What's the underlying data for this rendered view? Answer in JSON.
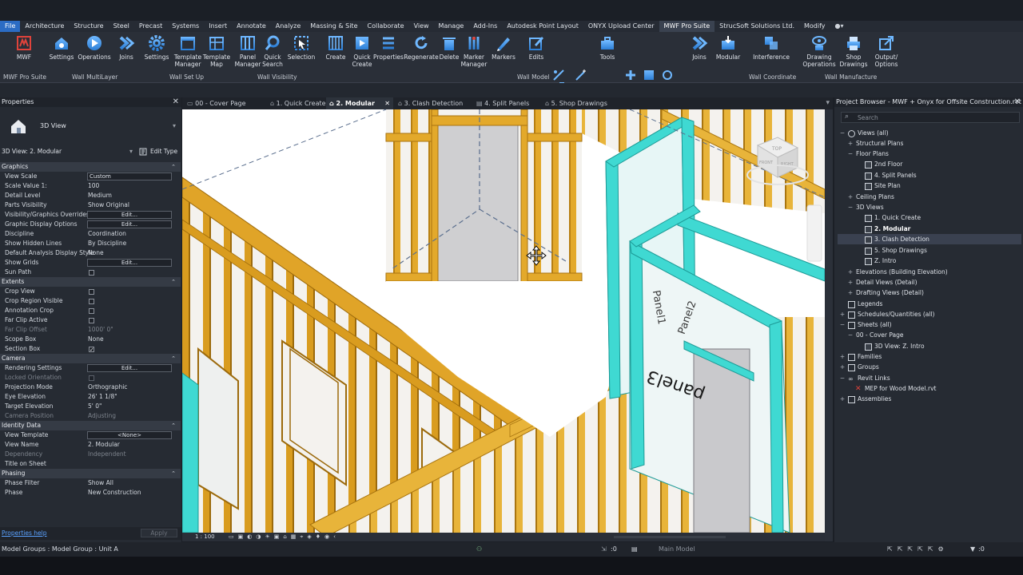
{
  "menus": [
    "File",
    "Architecture",
    "Structure",
    "Steel",
    "Precast",
    "Systems",
    "Insert",
    "Annotate",
    "Analyze",
    "Massing & Site",
    "Collaborate",
    "View",
    "Manage",
    "Add-Ins",
    "Autodesk Point Layout",
    "ONYX Upload Center",
    "MWF Pro Suite",
    "StrucSoft Solutions Ltd.",
    "Modify"
  ],
  "ribbon": {
    "buttons": {
      "mwf": "MWF",
      "settings1": "Settings",
      "operations": "Operations",
      "joins1": "Joins",
      "settings2": "Settings",
      "template_manager": "Template\nManager",
      "template_map": "Template\nMap",
      "panel_manager": "Panel\nManager",
      "quick_search": "Quick\nSearch",
      "selection": "Selection",
      "create": "Create",
      "quick_create": "Quick\nCreate",
      "properties": "Properties",
      "regenerate": "Regenerate",
      "delete": "Delete",
      "marker_manager": "Marker\nManager",
      "markers": "Markers",
      "edits": "Edits",
      "tools": "Tools",
      "joins2": "Joins",
      "modular": "Modular",
      "interference": "Interference",
      "drawing_operations": "Drawing\nOperations",
      "shop_drawings": "Shop\nDrawings",
      "output_options": "Output/\nOptions"
    },
    "groups": {
      "mwf_pro_suite": "MWF Pro Suite",
      "wall_multilayer": "Wall MultiLayer",
      "wall_set_up": "Wall Set Up",
      "wall_visibility": "Wall Visibility",
      "wall_model": "Wall Model",
      "wall_coordinate": "Wall Coordinate",
      "wall_manufacture": "Wall Manufacture"
    }
  },
  "properties": {
    "title": "Properties",
    "type_name": "3D View",
    "selector": "3D View: 2. Modular",
    "edit_type": "Edit Type",
    "sections": {
      "graphics": "Graphics",
      "extents": "Extents",
      "camera": "Camera",
      "identity": "Identity Data",
      "phasing": "Phasing"
    },
    "rows": {
      "view_scale": {
        "k": "View Scale",
        "v": "Custom"
      },
      "scale_value": {
        "k": "Scale Value    1:",
        "v": "100"
      },
      "detail_level": {
        "k": "Detail Level",
        "v": "Medium"
      },
      "parts_visibility": {
        "k": "Parts Visibility",
        "v": "Show Original"
      },
      "vg_overrides": {
        "k": "Visibility/Graphics Overrides",
        "v": "Edit..."
      },
      "graphic_display": {
        "k": "Graphic Display Options",
        "v": "Edit..."
      },
      "discipline": {
        "k": "Discipline",
        "v": "Coordination"
      },
      "hidden_lines": {
        "k": "Show Hidden Lines",
        "v": "By Discipline"
      },
      "analysis_style": {
        "k": "Default Analysis Display Style",
        "v": "None"
      },
      "show_grids": {
        "k": "Show Grids",
        "v": "Edit..."
      },
      "sun_path": {
        "k": "Sun Path"
      },
      "crop_view": {
        "k": "Crop View"
      },
      "crop_region": {
        "k": "Crop Region Visible"
      },
      "annotation_crop": {
        "k": "Annotation Crop"
      },
      "far_clip_active": {
        "k": "Far Clip Active"
      },
      "far_clip_offset": {
        "k": "Far Clip Offset",
        "v": "1000'  0\""
      },
      "scope_box": {
        "k": "Scope Box",
        "v": "None"
      },
      "section_box": {
        "k": "Section Box"
      },
      "rendering": {
        "k": "Rendering Settings",
        "v": "Edit..."
      },
      "locked_orientation": {
        "k": "Locked Orientation"
      },
      "projection": {
        "k": "Projection Mode",
        "v": "Orthographic"
      },
      "eye_elevation": {
        "k": "Eye Elevation",
        "v": "26'  1 1/8\""
      },
      "target_elevation": {
        "k": "Target Elevation",
        "v": "5'  0\""
      },
      "camera_position": {
        "k": "Camera Position",
        "v": "Adjusting"
      },
      "view_template": {
        "k": "View Template",
        "v": "<None>"
      },
      "view_name": {
        "k": "View Name",
        "v": "2. Modular"
      },
      "dependency": {
        "k": "Dependency",
        "v": "Independent"
      },
      "title_on_sheet": {
        "k": "Title on Sheet"
      },
      "phase_filter": {
        "k": "Phase Filter",
        "v": "Show All"
      },
      "phase": {
        "k": "Phase",
        "v": "New Construction"
      }
    },
    "help": "Properties help",
    "apply": "Apply"
  },
  "tabs": [
    "00 - Cover Page",
    "1. Quick Create",
    "2. Modular",
    "3. Clash Detection",
    "4. Split Panels",
    "5. Shop Drawings"
  ],
  "viewport": {
    "scale": "1 : 100",
    "viewcube": {
      "top": "TOP",
      "front": "FRONT",
      "right": "RIGHT"
    },
    "panel_labels": [
      "panel3",
      "Panel2",
      "Panel1"
    ]
  },
  "browser": {
    "title": "Project Browser - MWF + Onyx for Offsite Construction.rvt",
    "search": "Search",
    "items": {
      "views_all": "Views (all)",
      "structural_plans": "Structural Plans",
      "floor_plans": "Floor Plans",
      "second_floor": "2nd Floor",
      "split_panels": "4. Split Panels",
      "site_plan": "Site Plan",
      "ceiling_plans": "Ceiling Plans",
      "views_3d": "3D Views",
      "quick_create": "1. Quick Create",
      "modular": "2. Modular",
      "clash": "3. Clash Detection",
      "shop": "5. Shop Drawings",
      "z_intro": "Z. Intro",
      "elevations": "Elevations (Building Elevation)",
      "detail_views": "Detail Views (Detail)",
      "drafting_views": "Drafting Views (Detail)",
      "legends": "Legends",
      "schedules": "Schedules/Quantities (all)",
      "sheets": "Sheets (all)",
      "cover_page": "00 - Cover Page",
      "sheet_3d": "3D View: Z. Intro",
      "families": "Families",
      "groups": "Groups",
      "revit_links": "Revit Links",
      "mep_link": "MEP for Wood Model.rvt",
      "assemblies": "Assemblies"
    }
  },
  "status": {
    "left": "Model Groups : Model Group : Unit A",
    "zero1": ":0",
    "main_model": "Main Model",
    "zero2": ":0"
  },
  "colors": {
    "accent": "#2b6cc4",
    "wood": "#e3a92b",
    "steel": "#3fd9d2"
  }
}
